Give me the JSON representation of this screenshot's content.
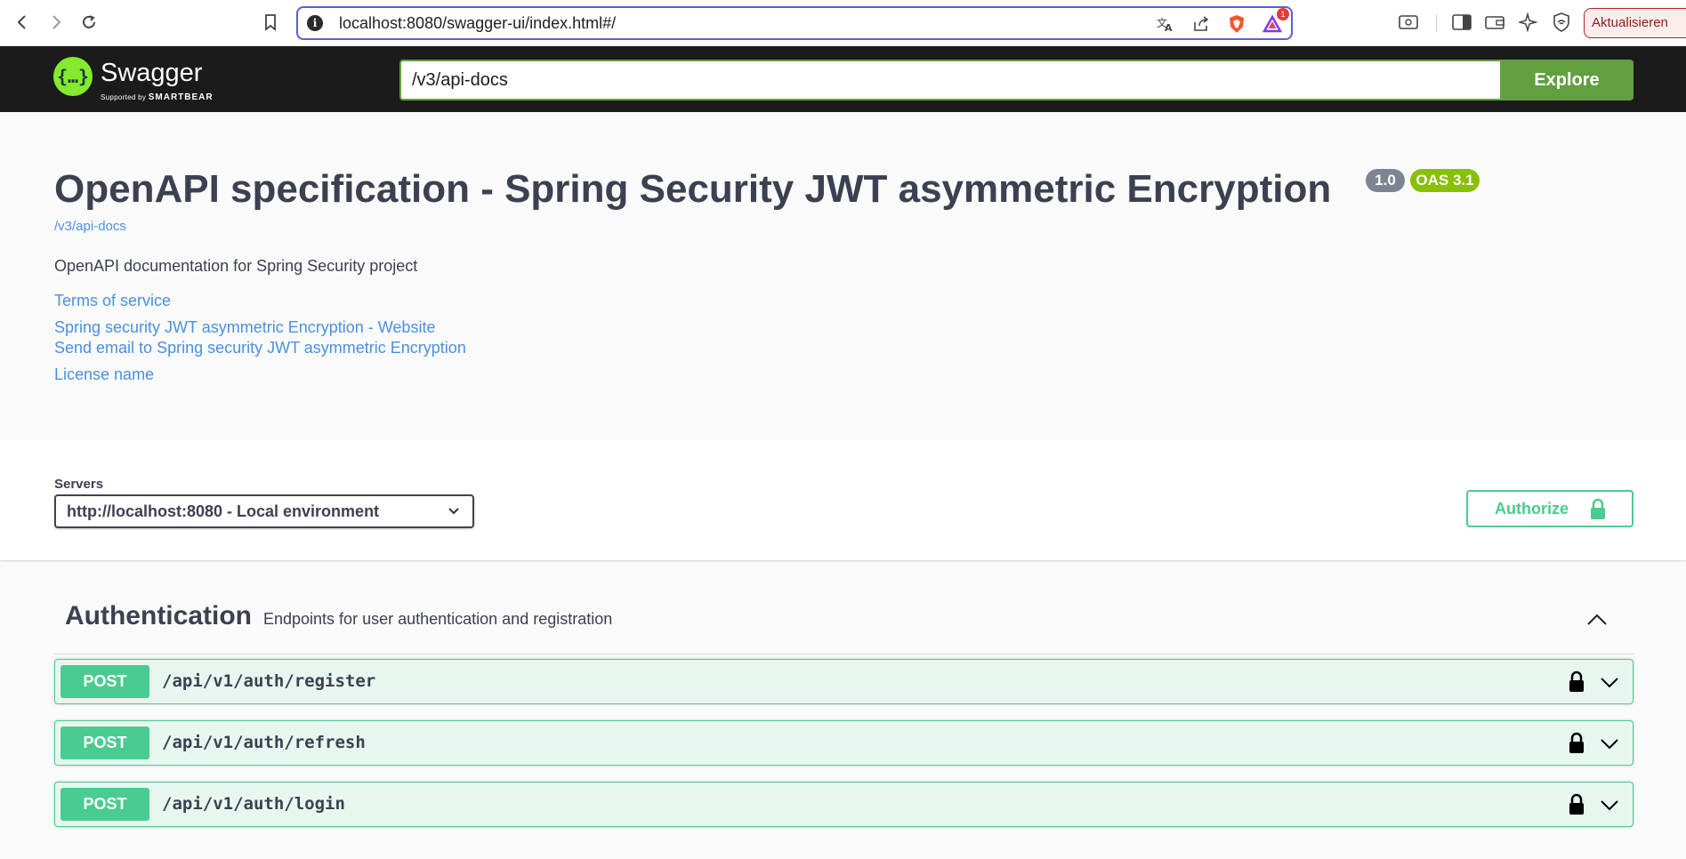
{
  "browser": {
    "url": "localhost:8080/swagger-ui/index.html#/",
    "update_label": "Aktualisieren",
    "notification_count": "1"
  },
  "topbar": {
    "logo_name": "Swagger",
    "logo_supported": "Supported by",
    "logo_brand": "SMARTBEAR",
    "spec_url": "/v3/api-docs",
    "explore_label": "Explore"
  },
  "info": {
    "title": "OpenAPI specification - Spring Security JWT asymmetric Encryption",
    "version": "1.0",
    "oas": "OAS 3.1",
    "spec_link": "/v3/api-docs",
    "description": "OpenAPI documentation for Spring Security project",
    "links": {
      "terms": "Terms of service",
      "website": "Spring security JWT asymmetric Encryption - Website",
      "email": "Send email to Spring security JWT asymmetric Encryption",
      "license": "License name"
    }
  },
  "servers": {
    "label": "Servers",
    "selected": "http://localhost:8080 - Local environment",
    "authorize_label": "Authorize"
  },
  "tag": {
    "name": "Authentication",
    "description": "Endpoints for user authentication and registration",
    "operations": [
      {
        "method": "POST",
        "path": "/api/v1/auth/register"
      },
      {
        "method": "POST",
        "path": "/api/v1/auth/refresh"
      },
      {
        "method": "POST",
        "path": "/api/v1/auth/login"
      }
    ]
  },
  "colors": {
    "post": "#49cc90",
    "explore": "#62a03f",
    "link": "#4990e2",
    "topbar": "#1b1b1b"
  }
}
